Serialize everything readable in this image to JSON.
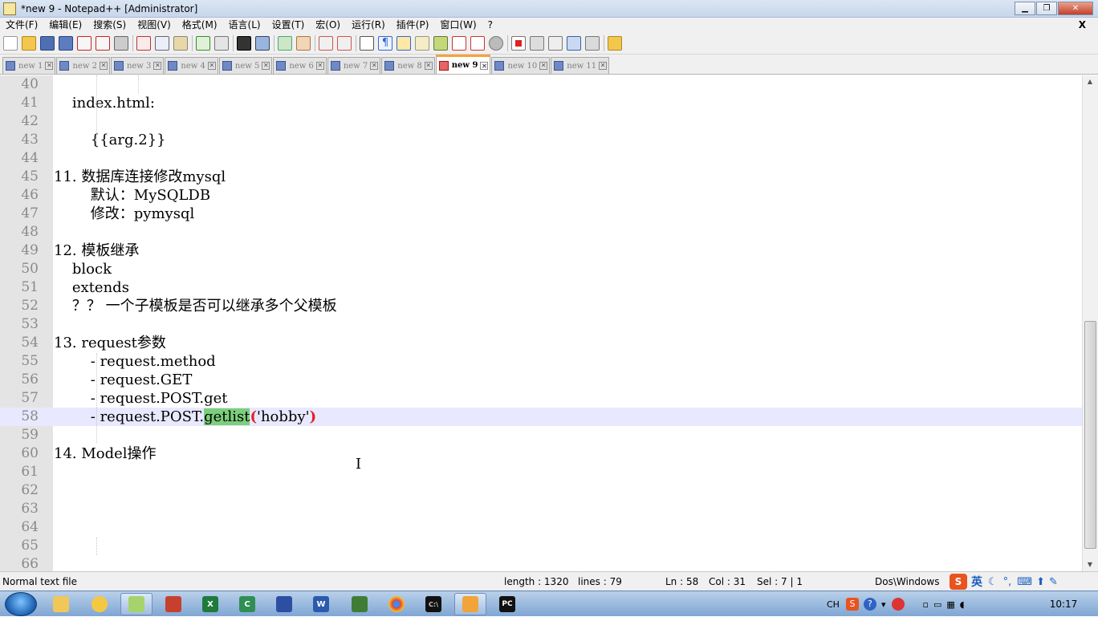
{
  "window": {
    "title": "*new 9 - Notepad++ [Administrator]"
  },
  "menu": [
    "文件(F)",
    "编辑(E)",
    "搜索(S)",
    "视图(V)",
    "格式(M)",
    "语言(L)",
    "设置(T)",
    "宏(O)",
    "运行(R)",
    "插件(P)",
    "窗口(W)",
    "?"
  ],
  "menu_close": "X",
  "tabs": [
    "new 1",
    "new 2",
    "new 3",
    "new 4",
    "new 5",
    "new 6",
    "new 7",
    "new 8",
    "new 9",
    "new 10",
    "new 11"
  ],
  "active_tab": "new 9",
  "editor": {
    "lines": [
      {
        "n": "40",
        "text": ""
      },
      {
        "n": "41",
        "text": "    index.html:"
      },
      {
        "n": "42",
        "text": ""
      },
      {
        "n": "43",
        "text": "        {{arg.2}}"
      },
      {
        "n": "44",
        "text": ""
      },
      {
        "n": "45",
        "text": "11. 数据库连接修改mysql"
      },
      {
        "n": "46",
        "text": "        默认：MySQLDB"
      },
      {
        "n": "47",
        "text": "        修改：pymysql"
      },
      {
        "n": "48",
        "text": ""
      },
      {
        "n": "49",
        "text": "12. 模板继承"
      },
      {
        "n": "50",
        "text": "    block"
      },
      {
        "n": "51",
        "text": "    extends"
      },
      {
        "n": "52",
        "text": "    ？？ 一个子模板是否可以继承多个父模板"
      },
      {
        "n": "53",
        "text": ""
      },
      {
        "n": "54",
        "text": "13. request参数"
      },
      {
        "n": "55",
        "text": "        - request.method"
      },
      {
        "n": "56",
        "text": "        - request.GET"
      },
      {
        "n": "57",
        "text": "        - request.POST.get"
      },
      {
        "n": "58",
        "text": ""
      },
      {
        "n": "59",
        "text": ""
      },
      {
        "n": "60",
        "text": "14. Model操作"
      },
      {
        "n": "61",
        "text": ""
      },
      {
        "n": "62",
        "text": ""
      },
      {
        "n": "63",
        "text": ""
      },
      {
        "n": "64",
        "text": ""
      },
      {
        "n": "65",
        "text": ""
      },
      {
        "n": "66",
        "text": ""
      }
    ],
    "current_line": {
      "prefix": "        - request.POST.",
      "highlight": "getlist",
      "open_paren": "(",
      "arg": "'hobby'",
      "close_paren": ")"
    }
  },
  "status": {
    "file_type": "Normal text file",
    "length": "length : 1320",
    "lines": "lines : 79",
    "ln": "Ln : 58",
    "col": "Col : 31",
    "sel": "Sel : 7 | 1",
    "eol": "Dos\\Windows"
  },
  "ime": {
    "logo": "S",
    "mode": "英"
  },
  "tray": {
    "lang": "CH"
  },
  "clock": "10:17",
  "colors": {
    "highlight": "#7ccf7c",
    "current_line": "#e8e8ff",
    "gutter": "#e4e4e4",
    "active_tab_accent": "#f9a23b"
  }
}
